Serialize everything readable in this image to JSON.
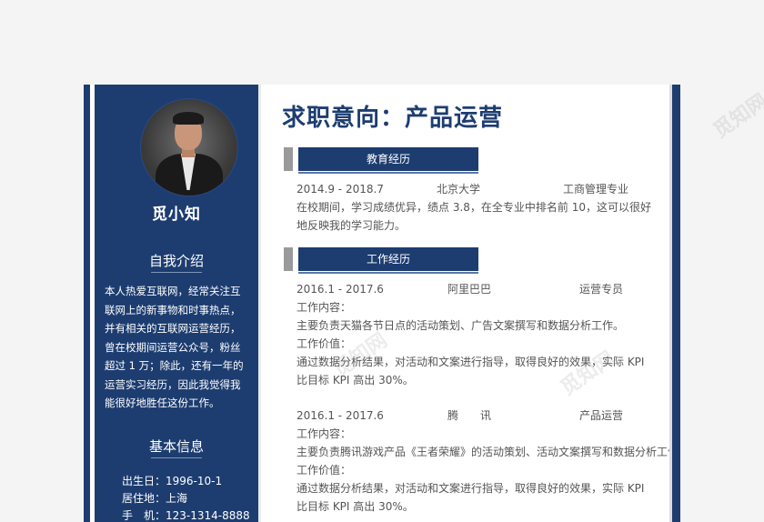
{
  "watermark": "觅知网",
  "sidebar": {
    "name": "觅小知",
    "intro_title": "自我介绍",
    "intro_lines": [
      "本人热爱互联网，经常关注互",
      "联网上的新事物和时事热点，",
      "并有相关的互联网运营经历，",
      "曾在校期间运营公众号，粉丝",
      "超过 1 万；除此，还有一年的",
      "运营实习经历，因此我觉得我",
      "能很好地胜任这份工作。"
    ],
    "info_title": "基本信息",
    "info_lines": [
      "出生日：1996-10-1",
      "居住地：上海",
      "手　机：123-1314-8888"
    ]
  },
  "main": {
    "title": "求职意向：产品运营",
    "education": {
      "heading": "教育经历",
      "period": "2014.9 - 2018.7",
      "school": "北京大学",
      "major": "工商管理专业",
      "desc": [
        "在校期间，学习成绩优异，绩点 3.8，在全专业中排名前 10，这可以很好",
        "地反映我的学习能力。"
      ]
    },
    "work": {
      "heading": "工作经历",
      "jobs": [
        {
          "period": "2016.1 - 2017.6",
          "company": "阿里巴巴",
          "role": "运营专员",
          "lines": [
            "工作内容：",
            "主要负责天猫各节日点的活动策划、广告文案撰写和数据分析工作。",
            "工作价值：",
            "通过数据分析结果，对活动和文案进行指导，取得良好的效果，实际 KPI",
            "比目标 KPI 高出 30%。"
          ]
        },
        {
          "period": "2016.1 - 2017.6",
          "company": "腾　　讯",
          "role": "产品运营",
          "lines": [
            "工作内容：",
            "主要负责腾讯游戏产品《王者荣耀》的活动策划、活动文案撰写和数据分析工作。",
            "工作价值：",
            "通过数据分析结果，对活动和文案进行指导，取得良好的效果，实际 KPI",
            "比目标 KPI 高出 30%。"
          ]
        }
      ]
    }
  }
}
